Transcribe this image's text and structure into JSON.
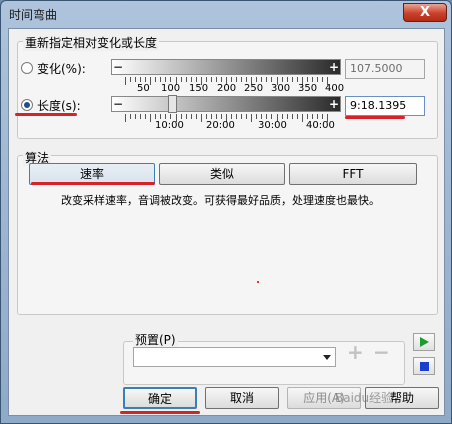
{
  "window": {
    "title": "时间弯曲",
    "close_label": "X"
  },
  "group_stretch": {
    "label": "重新指定相对变化或长度",
    "change_radio": {
      "label": "变化(%):",
      "selected": false
    },
    "change_slider": {
      "minus": "−",
      "plus": "+",
      "tick_labels": [
        "50",
        "100",
        "150",
        "200",
        "250",
        "300",
        "350",
        "400"
      ]
    },
    "change_value": "107.5000",
    "length_radio": {
      "label": "长度(s):",
      "selected": true
    },
    "length_slider": {
      "minus": "−",
      "plus": "+",
      "tick_labels": [
        "10:00",
        "20:00",
        "30:00",
        "40:00"
      ]
    },
    "length_value": "9:18.1395"
  },
  "algorithm": {
    "label": "算法",
    "buttons": [
      "速率",
      "类似",
      "FFT"
    ],
    "selected": "速率",
    "description": "改变采样速率，音调被改变。可获得最好品质，处理速度也最快。"
  },
  "preset": {
    "label": "预置(P)",
    "value": "",
    "add": "+",
    "remove": "−"
  },
  "footer": {
    "ok": "确定",
    "cancel": "取消",
    "apply": "应用(A)",
    "help": "帮助"
  },
  "watermark": "Baidu经验",
  "colors": {
    "highlight": "#d8222a",
    "play": "#1d9b2b",
    "stop": "#1a3fcf"
  }
}
